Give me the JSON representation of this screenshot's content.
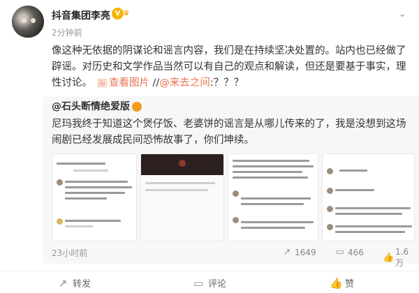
{
  "post": {
    "author": "抖音集团李亮",
    "time": "2分钟前",
    "body": "像这种无依据的阴谋论和谣言内容，我们是在持续坚决处置的。站内也已经做了辟谣。对历史和文学作品当然可以有自己的观点和解读，但还是要基于事实，理性讨论。",
    "view_image_label": "查看图片",
    "separator": "//",
    "mention": "@来去之间",
    "mention_suffix": ":？？？"
  },
  "retweet": {
    "author": "@石头断情绝爱版",
    "body": "尼玛我终于知道这个煲仔饭、老婆饼的谣言是从哪儿传来的了，我是没想到这场闹剧已经发展成民间恐怖故事了，你们坤续。",
    "time": "23小时前",
    "reposts": "1649",
    "comments": "466",
    "likes": "1.6万"
  },
  "footer": {
    "repost_label": "转发",
    "comment_label": "评论",
    "like_label": "赞"
  },
  "icons": {
    "more": "chevron-down-icon",
    "repost": "repost-icon",
    "comment": "comment-icon",
    "like": "thumbs-up-icon",
    "picture": "picture-icon"
  },
  "colors": {
    "link": "#eb7350",
    "retweet_bg": "#f7f7f7",
    "verified": "#f7b500"
  }
}
